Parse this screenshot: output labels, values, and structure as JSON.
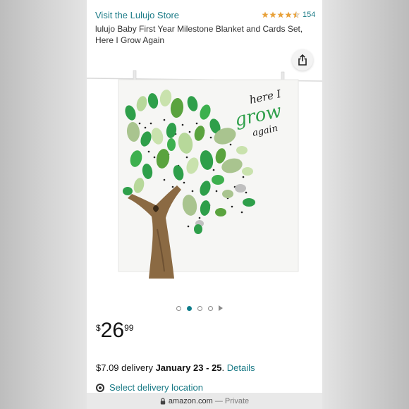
{
  "header": {
    "store_link": "Visit the Lulujo Store",
    "rating_count": "154",
    "rating_value": 4.5,
    "title": "lulujo Baby First Year Milestone Blanket and Cards Set, Here I Grow Again"
  },
  "image": {
    "blanket_text_line1": "here I",
    "blanket_text_line2": "grow",
    "blanket_text_line3": "again",
    "carousel_total": 4,
    "carousel_active": 2
  },
  "price": {
    "currency": "$",
    "whole": "26",
    "fraction": "99"
  },
  "delivery": {
    "prefix": "$7.09 delivery",
    "dates": "January 23 - 25",
    "separator": ".",
    "details_link": "Details"
  },
  "location": {
    "link": "Select delivery location"
  },
  "browser": {
    "domain": "amazon.com",
    "separator": "—",
    "mode": "Private"
  },
  "colors": {
    "link": "#1a7a86",
    "star": "#e8a13a",
    "carousel_active": "#0f7c8a",
    "leaf_green": "#2e9f4a"
  }
}
